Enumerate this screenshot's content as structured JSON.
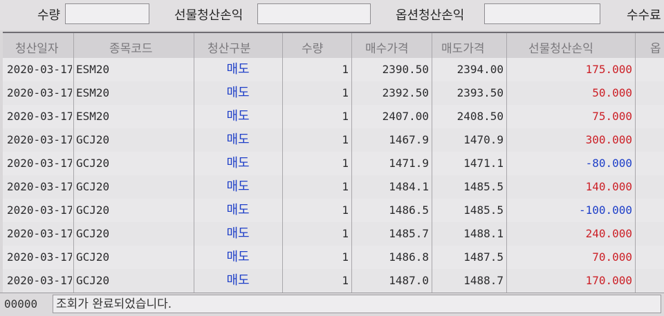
{
  "summary": {
    "qty_label": "수량",
    "qty_value": "",
    "futures_pnl_label": "선물청산손익",
    "futures_pnl_value": "",
    "options_pnl_label": "옵션청산손익",
    "options_pnl_value": "",
    "fee_label": "수수료"
  },
  "table": {
    "columns": [
      "청산일자",
      "종목코드",
      "청산구분",
      "수량",
      "매수가격",
      "매도가격",
      "선물청산손익",
      "옵"
    ],
    "rows": [
      {
        "date": "2020-03-17",
        "code": "ESM20",
        "side": "매도",
        "qty": "1",
        "buy": "2390.50",
        "sell": "2394.00",
        "pnl": "175.000",
        "pnl_color": "#cc1f26"
      },
      {
        "date": "2020-03-17",
        "code": "ESM20",
        "side": "매도",
        "qty": "1",
        "buy": "2392.50",
        "sell": "2393.50",
        "pnl": "50.000",
        "pnl_color": "#cc1f26"
      },
      {
        "date": "2020-03-17",
        "code": "ESM20",
        "side": "매도",
        "qty": "1",
        "buy": "2407.00",
        "sell": "2408.50",
        "pnl": "75.000",
        "pnl_color": "#cc1f26"
      },
      {
        "date": "2020-03-17",
        "code": "GCJ20",
        "side": "매도",
        "qty": "1",
        "buy": "1467.9",
        "sell": "1470.9",
        "pnl": "300.000",
        "pnl_color": "#cc1f26"
      },
      {
        "date": "2020-03-17",
        "code": "GCJ20",
        "side": "매도",
        "qty": "1",
        "buy": "1471.9",
        "sell": "1471.1",
        "pnl": "-80.000",
        "pnl_color": "#1e3fc8"
      },
      {
        "date": "2020-03-17",
        "code": "GCJ20",
        "side": "매도",
        "qty": "1",
        "buy": "1484.1",
        "sell": "1485.5",
        "pnl": "140.000",
        "pnl_color": "#cc1f26"
      },
      {
        "date": "2020-03-17",
        "code": "GCJ20",
        "side": "매도",
        "qty": "1",
        "buy": "1486.5",
        "sell": "1485.5",
        "pnl": "-100.000",
        "pnl_color": "#1e3fc8"
      },
      {
        "date": "2020-03-17",
        "code": "GCJ20",
        "side": "매도",
        "qty": "1",
        "buy": "1485.7",
        "sell": "1488.1",
        "pnl": "240.000",
        "pnl_color": "#cc1f26"
      },
      {
        "date": "2020-03-17",
        "code": "GCJ20",
        "side": "매도",
        "qty": "1",
        "buy": "1486.8",
        "sell": "1487.5",
        "pnl": "70.000",
        "pnl_color": "#cc1f26"
      },
      {
        "date": "2020-03-17",
        "code": "GCJ20",
        "side": "매도",
        "qty": "1",
        "buy": "1487.0",
        "sell": "1488.7",
        "pnl": "170.000",
        "pnl_color": "#cc1f26"
      }
    ]
  },
  "status": {
    "code": "00000",
    "message": "조회가 완료되었습니다."
  }
}
